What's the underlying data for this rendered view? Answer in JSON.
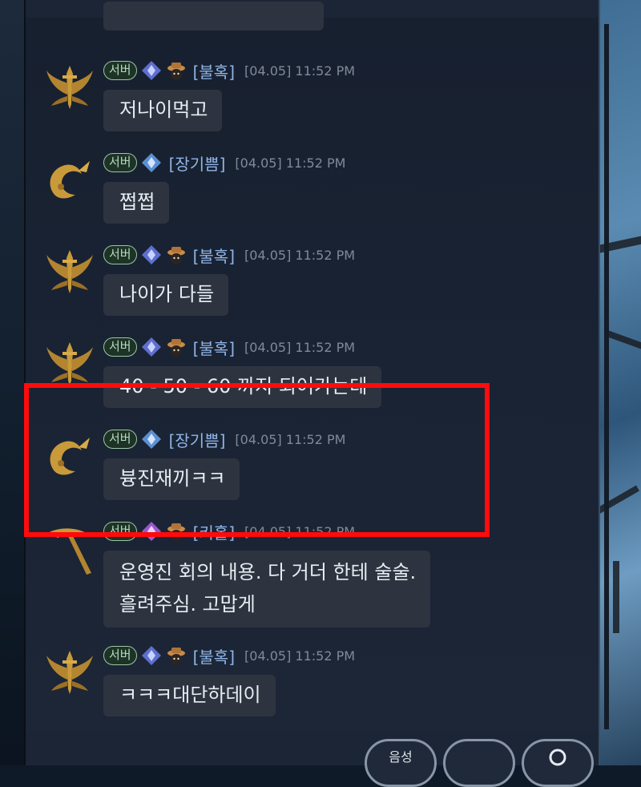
{
  "colors": {
    "name": "#8fb4e6",
    "time": "#7f8a99",
    "bubble_bg": "#2d3440",
    "bubble_text": "#e8ecf1",
    "server_badge": "#9cc6a6",
    "highlight": "#ff0b0b"
  },
  "messages": [
    {
      "server": "서버",
      "name": "[불혹]",
      "time": "[04.05] 11:52 PM",
      "text": "저나이먹고",
      "icon": "winged-sword-emblem-icon"
    },
    {
      "server": "서버",
      "name": "[장기쁨]",
      "time": "[04.05] 11:52 PM",
      "text": "쩝쩝",
      "icon": "scorpion-tail-emblem-icon"
    },
    {
      "server": "서버",
      "name": "[불혹]",
      "time": "[04.05] 11:52 PM",
      "text": "나이가 다들",
      "icon": "winged-sword-emblem-icon"
    },
    {
      "server": "서버",
      "name": "[불혹]",
      "time": "[04.05] 11:52 PM",
      "text": "40 - 50 - 60 까지 되어가는데",
      "icon": "winged-sword-emblem-icon"
    },
    {
      "server": "서버",
      "name": "[장기쁨]",
      "time": "[04.05] 11:52 PM",
      "text": "븅진재끼ㅋㅋ",
      "icon": "scorpion-tail-emblem-icon"
    },
    {
      "server": "서버",
      "name": "[키홀]",
      "time": "[04.05] 11:52 PM",
      "text": "운영진 회의 내용. 다 거더 한테  술술.",
      "text2": "흘려주심. 고맙게",
      "icon": "pickaxe-emblem-icon"
    },
    {
      "server": "서버",
      "name": "[불혹]",
      "time": "[04.05] 11:52 PM",
      "text": "ㅋㅋㅋ대단하데이",
      "icon": "winged-sword-emblem-icon"
    }
  ],
  "bottom_buttons": {
    "voice": "음성"
  }
}
